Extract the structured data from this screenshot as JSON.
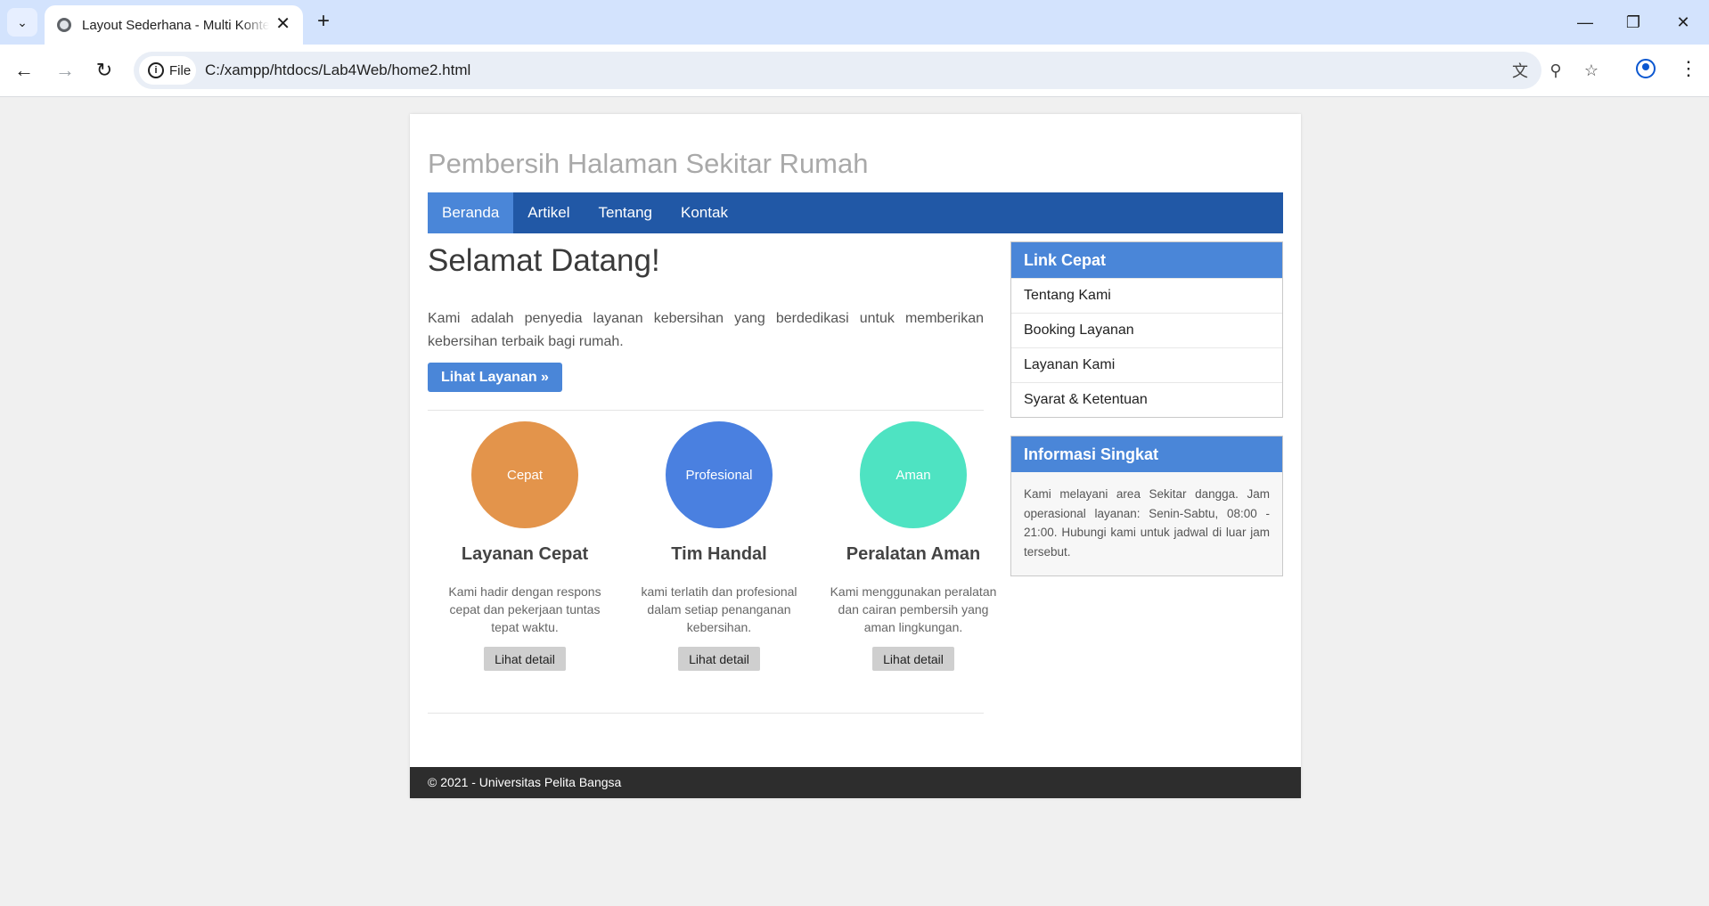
{
  "browser": {
    "tab_title": "Layout Sederhana - Multi Konten",
    "chip_label": "File",
    "url": "C:/xampp/htdocs/Lab4Web/home2.html",
    "icons": [
      "tab-search-icon",
      "favicon-icon",
      "close-icon",
      "plus-icon",
      "back-icon",
      "forward-icon",
      "reload-icon",
      "info-icon",
      "translate-icon",
      "zoom-icon",
      "star-icon",
      "profile-icon",
      "menu-icon",
      "minimize-icon",
      "restore-icon",
      "window-close-icon"
    ]
  },
  "site": {
    "title": "Pembersih Halaman Sekitar Rumah",
    "nav": [
      "Beranda",
      "Artikel",
      "Tentang",
      "Kontak"
    ],
    "active_nav": "Beranda",
    "accent_color": "#4a86d8",
    "nav_color": "#2158a6"
  },
  "main": {
    "heading": "Selamat Datang!",
    "intro": "Kami adalah penyedia layanan kebersihan yang berdedikasi untuk memberikan kebersihan terbaik bagi rumah.",
    "cta_label": "Lihat Layanan »",
    "features": [
      {
        "circle_label": "Cepat",
        "circle_color": "#e3944b",
        "title": "Layanan Cepat",
        "text": "Kami hadir dengan respons cepat dan pekerjaan tuntas tepat waktu.",
        "button": "Lihat detail"
      },
      {
        "circle_label": "Profesional",
        "circle_color": "#4a80e0",
        "title": "Tim Handal",
        "text": "kami terlatih dan profesional dalam setiap penanganan kebersihan.",
        "button": "Lihat detail"
      },
      {
        "circle_label": "Aman",
        "circle_color": "#4ee3c2",
        "title": "Peralatan Aman",
        "text": "Kami menggunakan peralatan dan cairan pembersih yang aman lingkungan.",
        "button": "Lihat detail"
      }
    ]
  },
  "sidebar": {
    "quick_links_title": "Link Cepat",
    "quick_links": [
      "Tentang Kami",
      "Booking Layanan",
      "Layanan Kami",
      "Syarat & Ketentuan"
    ],
    "info_title": "Informasi Singkat",
    "info_text": "Kami melayani area Sekitar dangga. Jam operasional layanan: Senin-Sabtu, 08:00 - 21:00. Hubungi kami untuk jadwal di luar jam tersebut."
  },
  "footer": {
    "text": "© 2021 - Universitas Pelita Bangsa"
  }
}
